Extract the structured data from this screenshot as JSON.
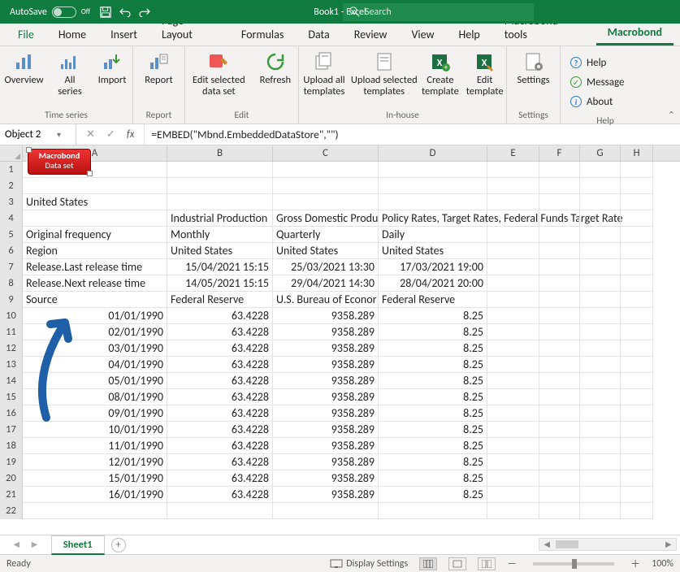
{
  "titlebar": {
    "autosave_label": "AutoSave",
    "autosave_state": "Off",
    "doc_title": "Book1 - Excel",
    "search_placeholder": "Search"
  },
  "tabs": [
    "File",
    "Home",
    "Insert",
    "Page Layout",
    "Formulas",
    "Data",
    "Review",
    "View",
    "Help",
    "Macrobond tools",
    "Macrobond"
  ],
  "active_tab": "Macrobond",
  "ribbon": {
    "groups": [
      {
        "label": "Time series",
        "buttons": [
          {
            "name": "overview",
            "label": "Overview"
          },
          {
            "name": "all-series",
            "label": "All\nseries"
          },
          {
            "name": "import",
            "label": "Import"
          }
        ]
      },
      {
        "label": "Report",
        "buttons": [
          {
            "name": "report",
            "label": "Report"
          }
        ]
      },
      {
        "label": "Edit",
        "buttons": [
          {
            "name": "edit-selected",
            "label": "Edit selected\ndata set"
          },
          {
            "name": "refresh",
            "label": "Refresh"
          }
        ]
      },
      {
        "label": "In-house",
        "buttons": [
          {
            "name": "upload-all",
            "label": "Upload all\ntemplates"
          },
          {
            "name": "upload-selected",
            "label": "Upload selected\ntemplates"
          },
          {
            "name": "create-template",
            "label": "Create\ntemplate"
          },
          {
            "name": "edit-template",
            "label": "Edit\ntemplate"
          }
        ]
      },
      {
        "label": "Settings",
        "buttons": [
          {
            "name": "settings",
            "label": "Settings"
          }
        ]
      }
    ],
    "help": {
      "label": "Help",
      "items": [
        {
          "name": "help",
          "label": "Help",
          "color": "#2b7cd3"
        },
        {
          "name": "message",
          "label": "Message",
          "color": "#3a9a3a"
        },
        {
          "name": "about",
          "label": "About",
          "color": "#2b7cd3"
        }
      ]
    }
  },
  "name_box": "Object 2",
  "formula": "=EMBED(\"Mbnd.EmbeddedDataStore\",\"\")",
  "columns": [
    "A",
    "B",
    "C",
    "D",
    "E",
    "F",
    "G",
    "H"
  ],
  "badge": {
    "line1": "Macrobond",
    "line2": "Data set"
  },
  "sheet": {
    "headers": {
      "3": {
        "A": "United States"
      },
      "4": {
        "B": "Industrial Production",
        "C": "Gross Domestic Produ",
        "D": "Policy Rates, Target Rates, Federal Funds Target Rate"
      },
      "5": {
        "A": "Original frequency",
        "B": "Monthly",
        "C": "Quarterly",
        "D": "Daily"
      },
      "6": {
        "A": "Region",
        "B": "United States",
        "C": "United States",
        "D": "United States"
      },
      "7": {
        "A": "Release.Last release time",
        "B": "15/04/2021 15:15",
        "C": "25/03/2021 13:30",
        "D": "17/03/2021 19:00"
      },
      "8": {
        "A": "Release.Next release time",
        "B": "14/05/2021 15:15",
        "C": "29/04/2021 14:30",
        "D": "28/04/2021 20:00"
      },
      "9": {
        "A": "Source",
        "B": "Federal Reserve",
        "C": "U.S. Bureau of Econor",
        "D": "Federal Reserve"
      }
    },
    "data_rows": [
      {
        "r": 10,
        "A": "01/01/1990",
        "B": "63.4228",
        "C": "9358.289",
        "D": "8.25"
      },
      {
        "r": 11,
        "A": "02/01/1990",
        "B": "63.4228",
        "C": "9358.289",
        "D": "8.25"
      },
      {
        "r": 12,
        "A": "03/01/1990",
        "B": "63.4228",
        "C": "9358.289",
        "D": "8.25"
      },
      {
        "r": 13,
        "A": "04/01/1990",
        "B": "63.4228",
        "C": "9358.289",
        "D": "8.25"
      },
      {
        "r": 14,
        "A": "05/01/1990",
        "B": "63.4228",
        "C": "9358.289",
        "D": "8.25"
      },
      {
        "r": 15,
        "A": "08/01/1990",
        "B": "63.4228",
        "C": "9358.289",
        "D": "8.25"
      },
      {
        "r": 16,
        "A": "09/01/1990",
        "B": "63.4228",
        "C": "9358.289",
        "D": "8.25"
      },
      {
        "r": 17,
        "A": "10/01/1990",
        "B": "63.4228",
        "C": "9358.289",
        "D": "8.25"
      },
      {
        "r": 18,
        "A": "11/01/1990",
        "B": "63.4228",
        "C": "9358.289",
        "D": "8.25"
      },
      {
        "r": 19,
        "A": "12/01/1990",
        "B": "63.4228",
        "C": "9358.289",
        "D": "8.25"
      },
      {
        "r": 20,
        "A": "15/01/1990",
        "B": "63.4228",
        "C": "9358.289",
        "D": "8.25"
      },
      {
        "r": 21,
        "A": "16/01/1990",
        "B": "63.4228",
        "C": "9358.289",
        "D": "8.25"
      }
    ]
  },
  "sheet_tab": "Sheet1",
  "status": {
    "ready": "Ready",
    "display": "Display Settings",
    "zoom": "100%"
  }
}
